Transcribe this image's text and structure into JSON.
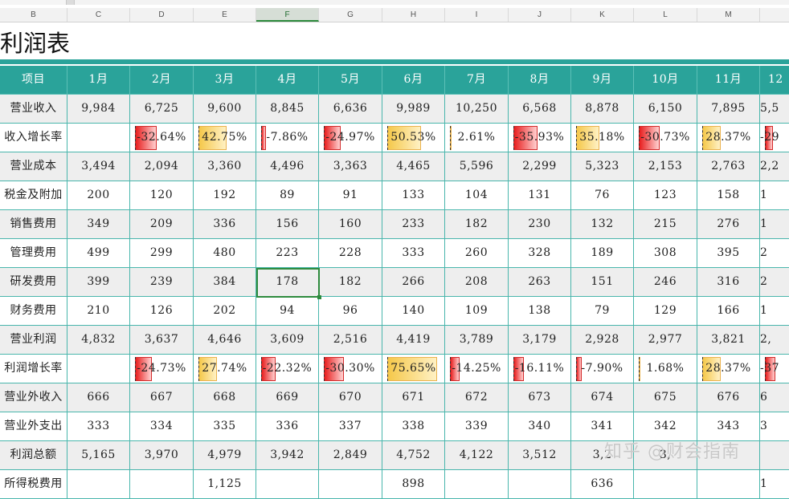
{
  "column_letters": [
    "B",
    "C",
    "D",
    "E",
    "F",
    "G",
    "H",
    "I",
    "J",
    "K",
    "L",
    "M"
  ],
  "selected_column": "F",
  "title": "利润表",
  "header": [
    "项目",
    "1月",
    "2月",
    "3月",
    "4月",
    "5月",
    "6月",
    "7月",
    "8月",
    "9月",
    "10月",
    "11月",
    "12"
  ],
  "rows": [
    {
      "label": "营业收入",
      "values": [
        "9,984",
        "6,725",
        "9,600",
        "8,845",
        "6,636",
        "9,989",
        "10,250",
        "6,568",
        "8,878",
        "6,150",
        "7,895",
        "5,5"
      ]
    },
    {
      "label": "收入增长率",
      "type": "pct",
      "values": [
        "",
        "-32.64%",
        "42.75%",
        "-7.86%",
        "-24.97%",
        "50.53%",
        "2.61%",
        "-35.93%",
        "35.18%",
        "-30.73%",
        "28.37%",
        "-29"
      ],
      "nums": [
        null,
        -32.64,
        42.75,
        -7.86,
        -24.97,
        50.53,
        2.61,
        -35.93,
        35.18,
        -30.73,
        28.37,
        -29
      ]
    },
    {
      "label": "营业成本",
      "values": [
        "3,494",
        "2,094",
        "3,360",
        "4,496",
        "3,363",
        "4,465",
        "5,596",
        "2,299",
        "5,323",
        "2,153",
        "2,763",
        "2,2"
      ]
    },
    {
      "label": "税金及附加",
      "values": [
        "200",
        "120",
        "192",
        "89",
        "91",
        "133",
        "104",
        "131",
        "76",
        "123",
        "158",
        "1"
      ]
    },
    {
      "label": "销售费用",
      "values": [
        "349",
        "209",
        "336",
        "156",
        "160",
        "233",
        "182",
        "230",
        "132",
        "215",
        "276",
        "1"
      ]
    },
    {
      "label": "管理费用",
      "values": [
        "499",
        "299",
        "480",
        "223",
        "228",
        "333",
        "260",
        "328",
        "189",
        "308",
        "395",
        "2"
      ]
    },
    {
      "label": "研发费用",
      "values": [
        "399",
        "239",
        "384",
        "178",
        "182",
        "266",
        "208",
        "263",
        "151",
        "246",
        "316",
        "2"
      ]
    },
    {
      "label": "财务费用",
      "values": [
        "210",
        "126",
        "202",
        "94",
        "96",
        "140",
        "109",
        "138",
        "79",
        "129",
        "166",
        "1"
      ]
    },
    {
      "label": "营业利润",
      "values": [
        "4,832",
        "3,637",
        "4,646",
        "3,609",
        "2,516",
        "4,419",
        "3,789",
        "3,179",
        "2,928",
        "2,977",
        "3,821",
        "2,"
      ]
    },
    {
      "label": "利润增长率",
      "type": "pct",
      "values": [
        "",
        "-24.73%",
        "27.74%",
        "-22.32%",
        "-30.30%",
        "75.65%",
        "-14.25%",
        "-16.11%",
        "-7.90%",
        "1.68%",
        "28.37%",
        "-37"
      ],
      "nums": [
        null,
        -24.73,
        27.74,
        -22.32,
        -30.3,
        75.65,
        -14.25,
        -16.11,
        -7.9,
        1.68,
        28.37,
        -37
      ]
    },
    {
      "label": "营业外收入",
      "values": [
        "666",
        "667",
        "668",
        "669",
        "670",
        "671",
        "672",
        "673",
        "674",
        "675",
        "676",
        "6"
      ]
    },
    {
      "label": "营业外支出",
      "values": [
        "333",
        "334",
        "335",
        "336",
        "337",
        "338",
        "339",
        "340",
        "341",
        "342",
        "343",
        "3"
      ]
    },
    {
      "label": "利润总额",
      "values": [
        "5,165",
        "3,970",
        "4,979",
        "3,942",
        "2,849",
        "4,752",
        "4,122",
        "3,512",
        "3,2",
        "3,",
        "",
        ""
      ]
    },
    {
      "label": "所得税费用",
      "values": [
        "",
        "",
        "1,125",
        "",
        "",
        "898",
        "",
        "",
        "636",
        "",
        "",
        "1"
      ]
    }
  ],
  "selected_cell": {
    "row_label": "研发费用",
    "column": "4月",
    "value": "178"
  },
  "watermark": "知乎 @财会指南",
  "colors": {
    "header_bg": "#2aa39a",
    "grid_line": "#49b6ac",
    "alt_row": "#eeeeee",
    "pos_bar": "#f5c84a",
    "neg_bar": "#e81f1f",
    "selection": "#2e8b3e"
  }
}
